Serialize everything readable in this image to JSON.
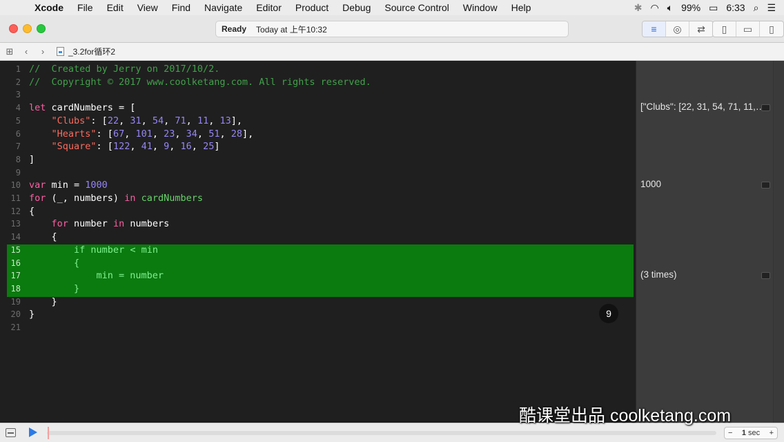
{
  "menubar": {
    "apple": "",
    "items": [
      "Xcode",
      "File",
      "Edit",
      "View",
      "Find",
      "Navigate",
      "Editor",
      "Product",
      "Debug",
      "Source Control",
      "Window",
      "Help"
    ],
    "battery": "99%",
    "clock": "6:33"
  },
  "toolbar": {
    "status": "Ready",
    "timestamp": "Today at 上午10:32"
  },
  "jumpbar": {
    "file_name": "_3.2for循环2"
  },
  "editor": {
    "highlighted_lines": [
      15,
      16,
      17,
      18
    ],
    "execution_count": "9",
    "lines": [
      {
        "n": "1",
        "code": "//  Created by Jerry on 2017/10/2."
      },
      {
        "n": "2",
        "code": "//  Copyright © 2017 www.coolketang.com. All rights reserved."
      },
      {
        "n": "3",
        "code": ""
      },
      {
        "n": "4",
        "code": "let cardNumbers = ["
      },
      {
        "n": "5",
        "code": "    \"Clubs\": [22, 31, 54, 71, 11, 13],"
      },
      {
        "n": "6",
        "code": "    \"Hearts\": [67, 101, 23, 34, 51, 28],"
      },
      {
        "n": "7",
        "code": "    \"Square\": [122, 41, 9, 16, 25]"
      },
      {
        "n": "8",
        "code": "]"
      },
      {
        "n": "9",
        "code": ""
      },
      {
        "n": "10",
        "code": "var min = 1000"
      },
      {
        "n": "11",
        "code": "for (_, numbers) in cardNumbers"
      },
      {
        "n": "12",
        "code": "{"
      },
      {
        "n": "13",
        "code": "    for number in numbers"
      },
      {
        "n": "14",
        "code": "    {"
      },
      {
        "n": "15",
        "code": "        if number < min"
      },
      {
        "n": "16",
        "code": "        {"
      },
      {
        "n": "17",
        "code": "            min = number"
      },
      {
        "n": "18",
        "code": "        }"
      },
      {
        "n": "19",
        "code": "    }"
      },
      {
        "n": "20",
        "code": "}"
      },
      {
        "n": "21",
        "code": ""
      }
    ]
  },
  "results": [
    {
      "line": 4,
      "text": "[\"Clubs\": [22, 31, 54, 71, 11,…"
    },
    {
      "line": 10,
      "text": "1000"
    },
    {
      "line": 17,
      "text": "(3 times)"
    }
  ],
  "bottombar": {
    "speed_value": "1",
    "speed_unit": "sec",
    "minus": "−",
    "plus": "+"
  },
  "watermark": "酷课堂出品 coolketang.com"
}
